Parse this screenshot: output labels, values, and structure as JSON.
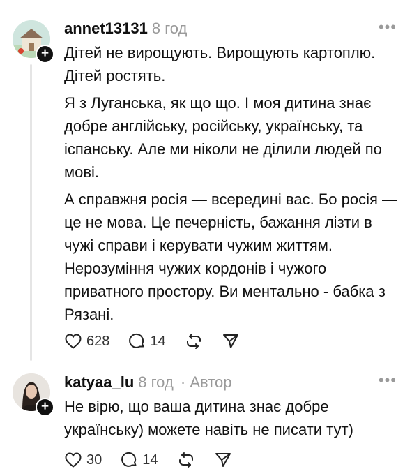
{
  "comments": [
    {
      "username": "annet13131",
      "time": "8 год",
      "author_tag": "",
      "more": "•••",
      "paragraphs": [
        "Дітей не вирощують. Вирощують картоплю. Дітей ростять.",
        "Я з Луганська, як що що. І моя дитина знає добре англійську, російську, українську, та іспанську. Але ми ніколи не ділили людей по мові.",
        "А справжня росія — всередині вас. Бо росія — це не мова. Це печерність, бажання лізти в чужі справи і керувати чужим життям. Нерозуміння чужих кордонів і чужого приватного простору. Ви ментально - бабка з Рязані."
      ],
      "likes": "628",
      "replies": "14"
    },
    {
      "username": "katyaa_lu",
      "time": "8 год",
      "author_tag": "· Автор",
      "more": "•••",
      "paragraphs": [
        "Не вірю, що ваша дитина знає добре українську) можете навіть не писати тут)"
      ],
      "likes": "30",
      "replies": "14"
    }
  ]
}
